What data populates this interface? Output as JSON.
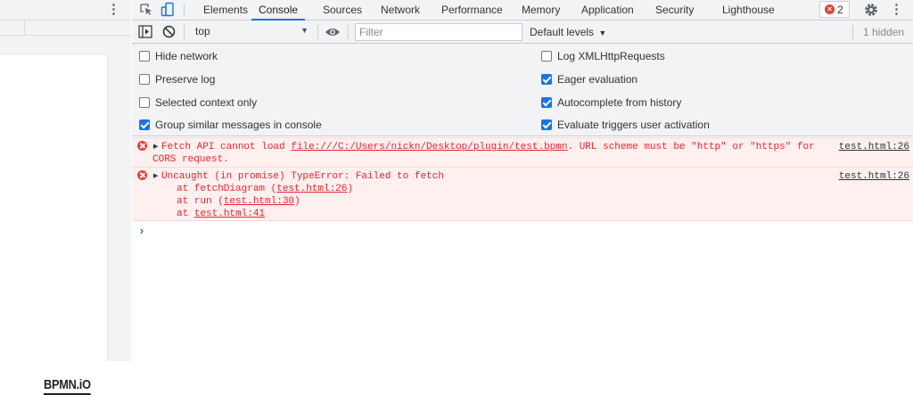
{
  "page": {
    "logo_text": "BPMN.iO"
  },
  "devtools": {
    "tabs": [
      {
        "label": "Elements"
      },
      {
        "label": "Console"
      },
      {
        "label": "Sources"
      },
      {
        "label": "Network"
      },
      {
        "label": "Performance"
      },
      {
        "label": "Memory"
      },
      {
        "label": "Application"
      },
      {
        "label": "Security"
      },
      {
        "label": "Lighthouse"
      }
    ],
    "active_tab": "Console",
    "error_count": "2",
    "accent_color": "#1a73e8",
    "error_color": "#e8262a"
  },
  "toolbar": {
    "context": "top",
    "filter_placeholder": "Filter",
    "levels": "Default levels",
    "hidden": "1 hidden"
  },
  "settings": {
    "left": [
      {
        "label": "Hide network",
        "checked": false
      },
      {
        "label": "Preserve log",
        "checked": false
      },
      {
        "label": "Selected context only",
        "checked": false
      },
      {
        "label": "Group similar messages in console",
        "checked": true
      }
    ],
    "right": [
      {
        "label": "Log XMLHttpRequests",
        "checked": false
      },
      {
        "label": "Eager evaluation",
        "checked": true
      },
      {
        "label": "Autocomplete from history",
        "checked": true
      },
      {
        "label": "Evaluate triggers user activation",
        "checked": true
      }
    ]
  },
  "messages": [
    {
      "pre": "Fetch API cannot load ",
      "link": "file:///C:/Users/nickn/Desktop/plugin/test.bpmn",
      "post": ". URL scheme must be \"http\" or \"https\" for",
      "line2": "CORS request.",
      "source": "test.html:26"
    },
    {
      "text": "Uncaught (in promise) TypeError: Failed to fetch",
      "stack": [
        {
          "pre": "at fetchDiagram (",
          "link": "test.html:26",
          "post": ")"
        },
        {
          "pre": "at run (",
          "link": "test.html:30",
          "post": ")"
        },
        {
          "pre": "at ",
          "link": "test.html:41",
          "post": ""
        }
      ],
      "source": "test.html:26"
    }
  ]
}
